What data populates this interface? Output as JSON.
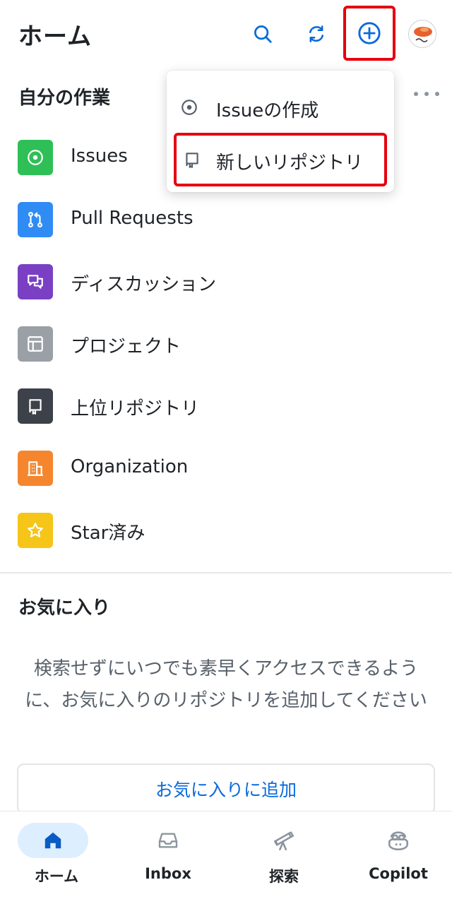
{
  "header": {
    "title": "ホーム",
    "icons": [
      "search-icon",
      "refresh-icon",
      "add-circle-icon",
      "avatar"
    ]
  },
  "dropdown_menu": {
    "items": [
      {
        "label": "Issueの作成",
        "icon": "issue-opened-icon"
      },
      {
        "label": "新しいリポジトリ",
        "icon": "repo-icon"
      }
    ]
  },
  "my_work": {
    "title": "自分の作業",
    "items": [
      {
        "label": "Issues",
        "icon": "issue-opened-icon",
        "color": "#2fbf57"
      },
      {
        "label": "Pull Requests",
        "icon": "pull-request-icon",
        "color": "#2f8cf5"
      },
      {
        "label": "ディスカッション",
        "icon": "discussion-icon",
        "color": "#7b3fc4"
      },
      {
        "label": "プロジェクト",
        "icon": "project-icon",
        "color": "#9aa0a6"
      },
      {
        "label": "上位リポジトリ",
        "icon": "repo-icon",
        "color": "#3d4149"
      },
      {
        "label": "Organization",
        "icon": "organization-icon",
        "color": "#f5862e"
      },
      {
        "label": "Star済み",
        "icon": "star-icon",
        "color": "#f5c518"
      }
    ]
  },
  "favorites": {
    "title": "お気に入り",
    "description": "検索せずにいつでも素早くアクセスできるように、お気に入りのリポジトリを追加してください",
    "button_label": "お気に入りに追加"
  },
  "tabbar": {
    "tabs": [
      {
        "label": "ホーム",
        "icon": "home-icon",
        "active": true
      },
      {
        "label": "Inbox",
        "icon": "inbox-icon",
        "active": false
      },
      {
        "label": "探索",
        "icon": "telescope-icon",
        "active": false
      },
      {
        "label": "Copilot",
        "icon": "copilot-icon",
        "active": false
      }
    ]
  },
  "colors": {
    "accent": "#0969da",
    "highlight_box": "#e5000f"
  }
}
